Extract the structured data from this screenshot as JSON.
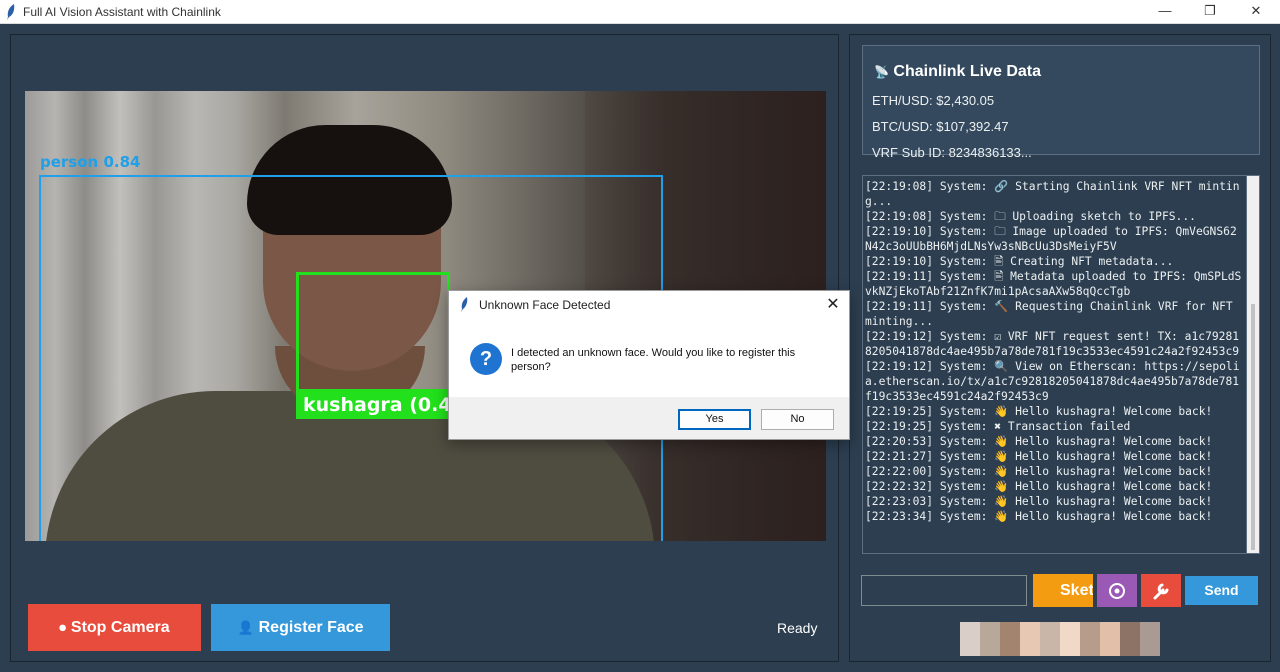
{
  "window": {
    "title": "Full AI Vision Assistant with Chainlink",
    "minimize": "—",
    "maximize": "❐",
    "close": "✕"
  },
  "video": {
    "person_label": "person 0.84",
    "face_label": "kushagra (0.46"
  },
  "controls": {
    "stop_camera_label": "Stop Camera",
    "register_face_label": "Register Face",
    "status": "Ready"
  },
  "chainlink": {
    "title": "Chainlink Live Data",
    "eth_usd": "ETH/USD: $2,430.05",
    "btc_usd": "BTC/USD: $107,392.47",
    "vrf_sub_id": "VRF Sub ID: 8234836133..."
  },
  "log": {
    "text": "[22:19:08] System: 🔗 Starting Chainlink VRF NFT minting...\n[22:19:08] System: 🗀 Uploading sketch to IPFS...\n[22:19:10] System: 🗀 Image uploaded to IPFS: QmVeGNS62N42c3oUUbBH6MjdLNsYw3sNBcUu3DsMeiyF5V\n[22:19:10] System: 🖹 Creating NFT metadata...\n[22:19:11] System: 🖹 Metadata uploaded to IPFS: QmSPLdSvkNZjEkoTAbf21ZnfK7mi1pAcsaAXw58qQccTgb\n[22:19:11] System: 🔨 Requesting Chainlink VRF for NFT minting...\n[22:19:12] System: ☑ VRF NFT request sent! TX: a1c792818205041878dc4ae495b7a78de781f19c3533ec4591c24a2f92453c9\n[22:19:12] System: 🔍 View on Etherscan: https://sepolia.etherscan.io/tx/a1c7c92818205041878dc4ae495b7a78de781f19c3533ec4591c24a2f92453c9\n[22:19:25] System: 👋 Hello kushagra! Welcome back!\n[22:19:25] System: ✖ Transaction failed\n[22:20:53] System: 👋 Hello kushagra! Welcome back!\n[22:21:27] System: 👋 Hello kushagra! Welcome back!\n[22:22:00] System: 👋 Hello kushagra! Welcome back!\n[22:22:32] System: 👋 Hello kushagra! Welcome back!\n[22:23:03] System: 👋 Hello kushagra! Welcome back!\n[22:23:34] System: 👋 Hello kushagra! Welcome back!"
  },
  "chat": {
    "input_value": "",
    "sketch_label": "Sketch",
    "send_label": "Send"
  },
  "dialog": {
    "title": "Unknown Face Detected",
    "close": "✕",
    "icon": "?",
    "message": "I detected an unknown face. Would you like to register this person?",
    "yes_label": "Yes",
    "no_label": "No"
  },
  "colors": {
    "background": "#2c3e50",
    "stop_button": "#e74c3c",
    "register_button": "#3498db",
    "sketch_button": "#f39c12",
    "vision_button": "#9b59b6",
    "tool_button": "#e74c3c",
    "send_button": "#3498db",
    "person_box": "#20a0e8",
    "face_box": "#22e01c"
  },
  "icons": {
    "app": "feather-icon",
    "stop": "camera-icon",
    "register": "person-icon",
    "chainlink": "satellite-icon",
    "vision": "eye-icon",
    "tool": "wrench-icon",
    "dialog": "question-icon"
  }
}
